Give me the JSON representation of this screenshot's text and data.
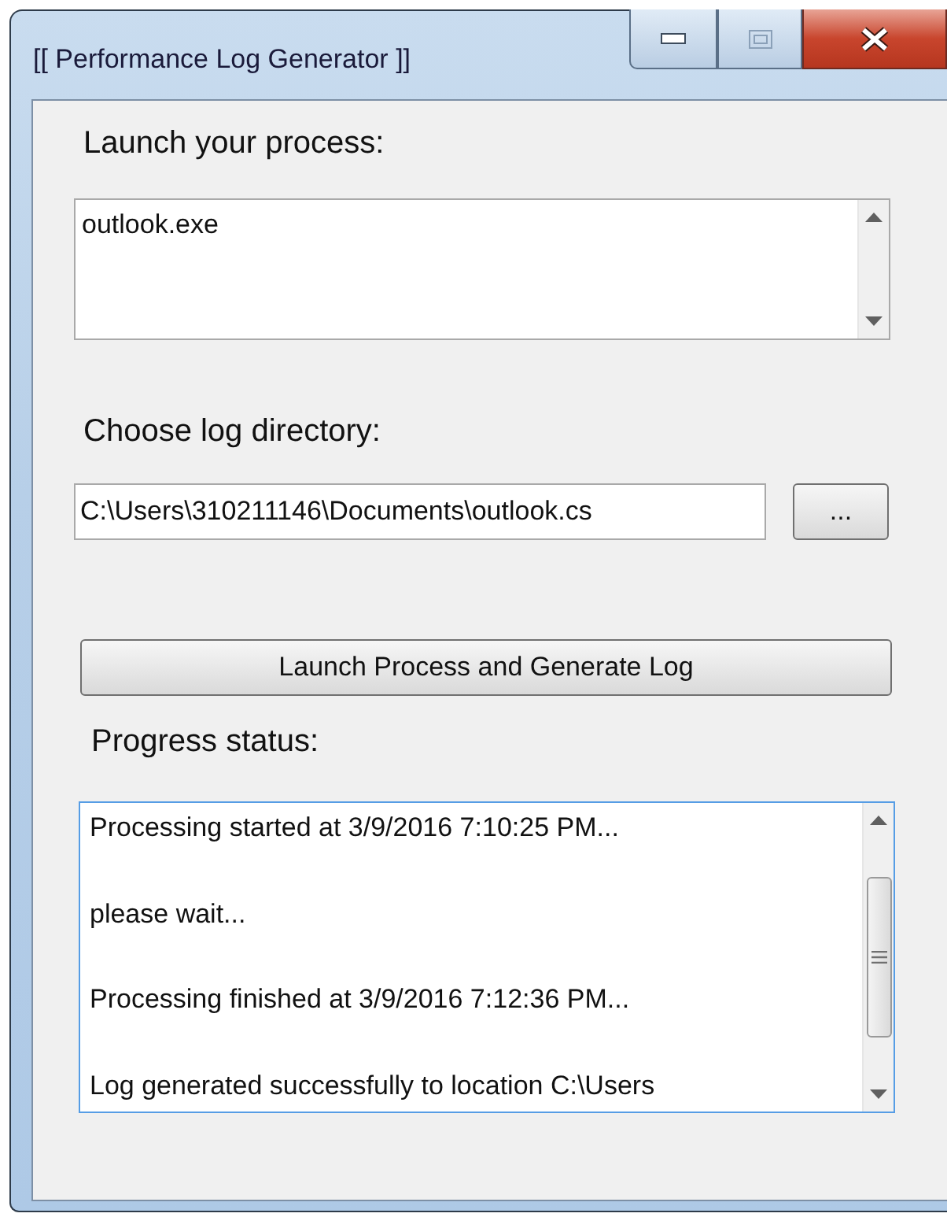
{
  "window": {
    "title": "[[ Performance Log Generator ]]"
  },
  "process": {
    "label": "Launch your process:",
    "value": "outlook.exe"
  },
  "log_directory": {
    "label": "Choose log directory:",
    "value": "C:\\Users\\310211146\\Documents\\outlook.cs",
    "browse_button": "..."
  },
  "launch_button": "Launch Process and Generate Log",
  "progress": {
    "label": "Progress status:",
    "lines": [
      "Processing started at 3/9/2016 7:10:25 PM...",
      "please wait...",
      "Processing finished at 3/9/2016 7:12:36 PM...",
      "Log generated successfully to location C:\\Users"
    ]
  }
}
